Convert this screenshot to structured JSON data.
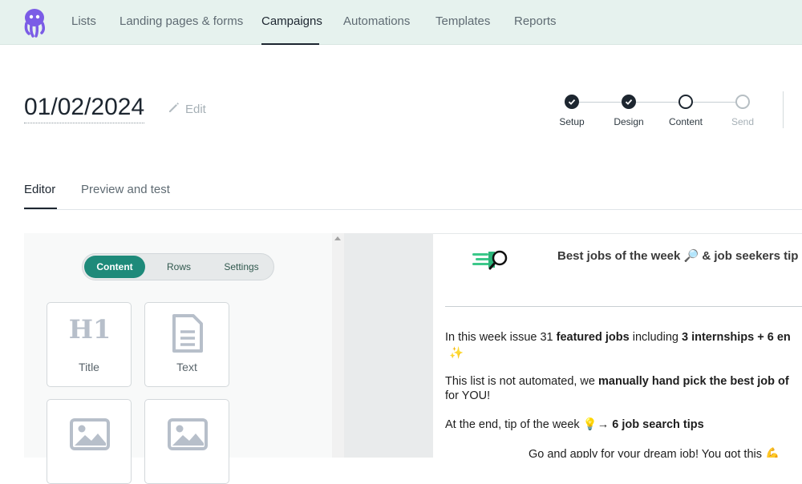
{
  "nav": {
    "items": [
      {
        "label": "Lists"
      },
      {
        "label": "Landing pages & forms"
      },
      {
        "label": "Campaigns"
      },
      {
        "label": "Automations"
      },
      {
        "label": "Templates"
      },
      {
        "label": "Reports"
      }
    ],
    "active": "Campaigns"
  },
  "campaign": {
    "title": "01/02/2024",
    "edit_label": "Edit"
  },
  "steps": [
    {
      "label": "Setup",
      "state": "done"
    },
    {
      "label": "Design",
      "state": "done"
    },
    {
      "label": "Content",
      "state": "current"
    },
    {
      "label": "Send",
      "state": "future"
    }
  ],
  "tabs": [
    {
      "label": "Editor"
    },
    {
      "label": "Preview and test"
    }
  ],
  "editor": {
    "segments": [
      {
        "label": "Content"
      },
      {
        "label": "Rows"
      },
      {
        "label": "Settings"
      }
    ],
    "blocks": [
      {
        "label": "Title",
        "icon": "heading-h1-icon"
      },
      {
        "label": "Text",
        "icon": "document-icon"
      },
      {
        "label": "",
        "icon": "image-icon"
      },
      {
        "label": "",
        "icon": "image-icon"
      }
    ]
  },
  "email": {
    "header_text": "Best jobs of the week 🔎 & job seekers tip",
    "p1_a": "In this week issue 31 ",
    "p1_b": "featured jobs",
    "p1_c": " including ",
    "p1_d": "3 internships + 6 en",
    "p1_sparkle": "✨",
    "p2_a": "This list is not automated, we ",
    "p2_b": "manually hand pick the best job of",
    "p2_c": "for YOU!",
    "p3_a": "At the end, tip of the week 💡→ ",
    "p3_b": "6 job search tips",
    "p4": "Go and apply for your dream job! You got this 💪"
  },
  "colors": {
    "nav_bg": "#e6f2ee",
    "brand_purple": "#7b5ce6",
    "accent_teal": "#1e8a7a",
    "text_dark": "#1d2630"
  }
}
